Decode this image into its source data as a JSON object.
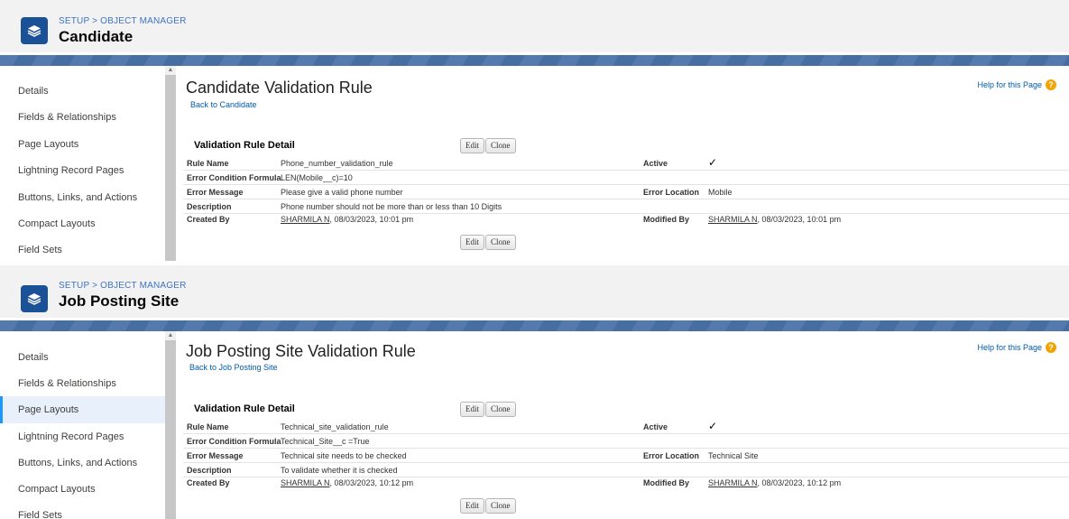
{
  "panels": [
    {
      "breadcrumb": "SETUP > OBJECT MANAGER",
      "object_title": "Candidate",
      "sidebar": [
        "Details",
        "Fields & Relationships",
        "Page Layouts",
        "Lightning Record Pages",
        "Buttons, Links, and Actions",
        "Compact Layouts",
        "Field Sets"
      ],
      "page_title": "Candidate Validation Rule",
      "back_link": "Back to Candidate",
      "help_link": "Help for this Page",
      "section_title": "Validation Rule Detail",
      "edit_label": "Edit",
      "clone_label": "Clone",
      "rule_name_label": "Rule Name",
      "rule_name": "Phone_number_validation_rule",
      "active_label": "Active",
      "active_mark": "✓",
      "formula_label": "Error Condition Formula",
      "formula": "LEN(Mobile__c)=10",
      "message_label": "Error Message",
      "message": "Please give a valid phone number",
      "location_label": "Error Location",
      "location": "Mobile",
      "description_label": "Description",
      "description": "Phone number should not be more than or less than 10 Digits",
      "created_by_label": "Created By",
      "created_by_user": "SHARMILA N",
      "created_by_date": ", 08/03/2023, 10:01 pm",
      "modified_by_label": "Modified By",
      "modified_by_user": "SHARMILA N",
      "modified_by_date": ", 08/03/2023, 10:01 pm"
    },
    {
      "breadcrumb": "SETUP > OBJECT MANAGER",
      "object_title": "Job Posting Site",
      "sidebar": [
        "Details",
        "Fields & Relationships",
        "Page Layouts",
        "Lightning Record Pages",
        "Buttons, Links, and Actions",
        "Compact Layouts",
        "Field Sets"
      ],
      "page_title": "Job Posting Site Validation Rule",
      "back_link": "Back to Job Posting Site",
      "help_link": "Help for this Page",
      "section_title": "Validation Rule Detail",
      "edit_label": "Edit",
      "clone_label": "Clone",
      "rule_name_label": "Rule Name",
      "rule_name": "Technical_site_validation_rule",
      "active_label": "Active",
      "active_mark": "✓",
      "formula_label": "Error Condition Formula",
      "formula": "Technical_Site__c =True",
      "message_label": "Error Message",
      "message": "Technical site needs to be checked",
      "location_label": "Error Location",
      "location": "Technical Site",
      "description_label": "Description",
      "description": "To validate whether it is checked",
      "created_by_label": "Created By",
      "created_by_user": "SHARMILA N",
      "created_by_date": ", 08/03/2023, 10:12 pm",
      "modified_by_label": "Modified By",
      "modified_by_user": "SHARMILA N",
      "modified_by_date": ", 08/03/2023, 10:12 pm"
    }
  ],
  "colors": {
    "brand": "#1b5297",
    "band": "#4a72a8",
    "link": "#015ba7",
    "help_icon": "#f3a300"
  },
  "icons": {
    "object": "layers-icon",
    "help": "help-icon",
    "check": "checkmark-icon"
  },
  "help_icon_glyph": "?",
  "scroll_up_glyph": "▲"
}
